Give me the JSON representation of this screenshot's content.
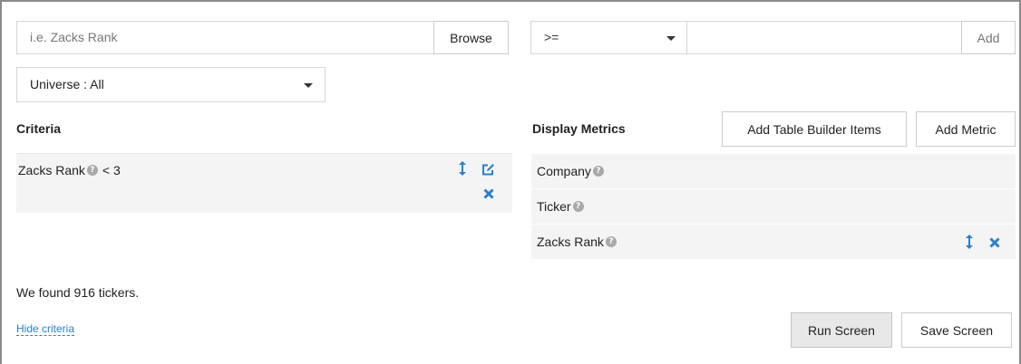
{
  "search": {
    "placeholder": "i.e. Zacks Rank",
    "browse_label": "Browse"
  },
  "operator": {
    "selected": ">=",
    "value": "",
    "add_label": "Add"
  },
  "universe": {
    "selected": "Universe : All"
  },
  "criteria": {
    "heading": "Criteria",
    "items": [
      {
        "name": "Zacks Rank",
        "condition": "< 3"
      }
    ]
  },
  "display_metrics": {
    "heading": "Display Metrics",
    "add_table_builder_label": "Add Table Builder Items",
    "add_metric_label": "Add Metric",
    "items": [
      {
        "label": "Company"
      },
      {
        "label": "Ticker"
      },
      {
        "label": "Zacks Rank"
      }
    ]
  },
  "result": {
    "text": "We found 916 tickers."
  },
  "hide_criteria_label": "Hide criteria",
  "run_screen_label": "Run Screen",
  "save_screen_label": "Save Screen",
  "colors": {
    "accent": "#2a7fc9",
    "row_bg": "#f4f4f4",
    "run_bg": "#e8e8e8"
  },
  "icons": {
    "help": "?",
    "move": "move-vertical-icon",
    "edit": "edit-icon",
    "remove": "close-icon"
  }
}
